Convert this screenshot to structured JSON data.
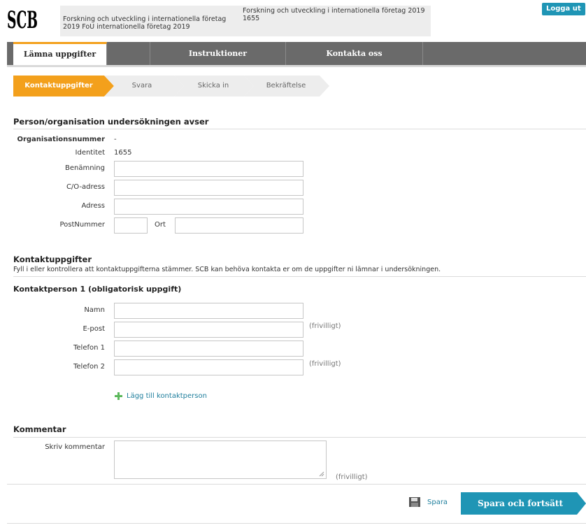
{
  "header": {
    "logo_text": "SCB",
    "survey_left_line1": "Forskning och utveckling i internationella företag",
    "survey_left_line2": "2019 FoU internationella företag 2019",
    "survey_right_line1": "Forskning och utveckling i internationella företag 2019",
    "survey_right_line2": "1655",
    "logout_label": "Logga ut"
  },
  "tabs": [
    {
      "label": "Lämna uppgifter"
    },
    {
      "label": ""
    },
    {
      "label": "Instruktioner"
    },
    {
      "label": "Kontakta oss"
    },
    {
      "label": ""
    }
  ],
  "steps": [
    {
      "label": "Kontaktuppgifter"
    },
    {
      "label": "Svara"
    },
    {
      "label": "Skicka in"
    },
    {
      "label": "Bekräftelse"
    }
  ],
  "organisation": {
    "title": "Person/organisation undersökningen avser",
    "orgnr_label": "Organisationsnummer",
    "orgnr_value": "-",
    "identity_label": "Identitet",
    "identity_value": "1655",
    "name_label": "Benämning",
    "co_label": "C/O-adress",
    "address_label": "Adress",
    "postal_label": "PostNummer",
    "city_label": "Ort",
    "name_value": "",
    "co_value": "",
    "address_value": "",
    "postal_value": "",
    "city_value": ""
  },
  "contact": {
    "title": "Kontaktuppgifter",
    "description": "Fyll i eller kontrollera att kontaktuppgifterna stämmer. SCB kan behöva kontakta er om de uppgifter ni lämnar i undersökningen.",
    "person_title": "Kontaktperson 1 (obligatorisk uppgift)",
    "name_label": "Namn",
    "email_label": "E-post",
    "phone1_label": "Telefon 1",
    "phone2_label": "Telefon 2",
    "optional_hint": "(frivilligt)",
    "add_contact_label": "Lägg till kontaktperson"
  },
  "comment": {
    "title": "Kommentar",
    "label": "Skriv kommentar",
    "optional_hint": "(frivilligt)",
    "value": ""
  },
  "actions": {
    "save_label": "Spara",
    "save_continue_label": "Spara och fortsätt"
  },
  "colors": {
    "accent_orange": "#f3a01c",
    "button_teal": "#1f95b5",
    "tab_gray": "#6a6a6a"
  }
}
